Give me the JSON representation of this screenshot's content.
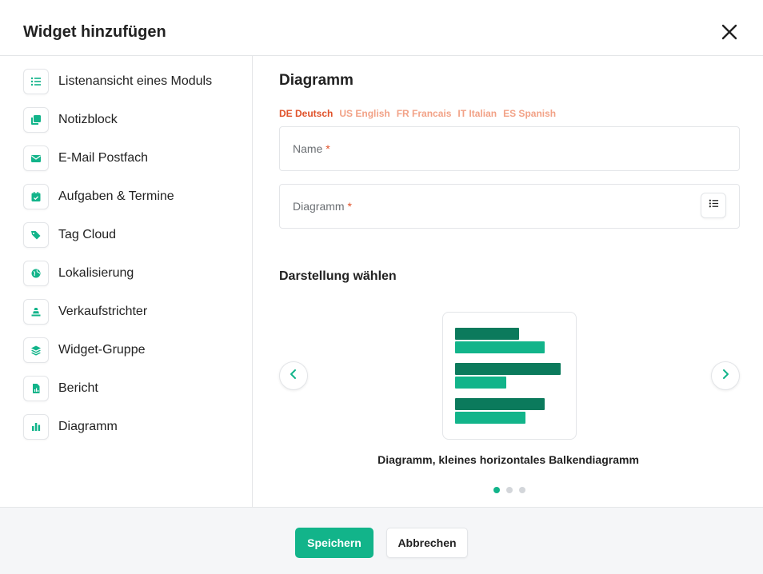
{
  "dialog": {
    "title": "Widget hinzufügen",
    "close_icon": "close-icon"
  },
  "sidebar": {
    "items": [
      {
        "label": "Listenansicht eines Moduls",
        "icon": "list-icon"
      },
      {
        "label": "Notizblock",
        "icon": "notes-icon"
      },
      {
        "label": "E-Mail Postfach",
        "icon": "envelope-icon"
      },
      {
        "label": "Aufgaben & Termine",
        "icon": "calendar-check-icon"
      },
      {
        "label": "Tag Cloud",
        "icon": "tags-icon"
      },
      {
        "label": "Lokalisierung",
        "icon": "globe-icon"
      },
      {
        "label": "Verkaufstrichter",
        "icon": "funnel-icon"
      },
      {
        "label": "Widget-Gruppe",
        "icon": "layers-icon"
      },
      {
        "label": "Bericht",
        "icon": "report-file-icon"
      },
      {
        "label": "Diagramm",
        "icon": "bar-chart-icon"
      }
    ]
  },
  "main": {
    "heading": "Diagramm",
    "languages": [
      {
        "label": "DE Deutsch",
        "active": true
      },
      {
        "label": "US English",
        "active": false
      },
      {
        "label": "FR Francais",
        "active": false
      },
      {
        "label": "IT Italian",
        "active": false
      },
      {
        "label": "ES Spanish",
        "active": false
      }
    ],
    "fields": {
      "name_label": "Name",
      "diagram_label": "Diagramm",
      "required_mark": "*"
    },
    "display_section_title": "Darstellung wählen",
    "carousel": {
      "caption": "Diagramm, kleines horizontales Balkendiagramm",
      "slide_count": 3,
      "active_slide": 1
    }
  },
  "footer": {
    "save_label": "Speichern",
    "cancel_label": "Abbrechen"
  },
  "colors": {
    "accent": "#12b48a",
    "accent_dark": "#0b7a5c",
    "language_active": "#e0522a",
    "language_inactive": "#f2a287",
    "required": "#e0522a"
  }
}
